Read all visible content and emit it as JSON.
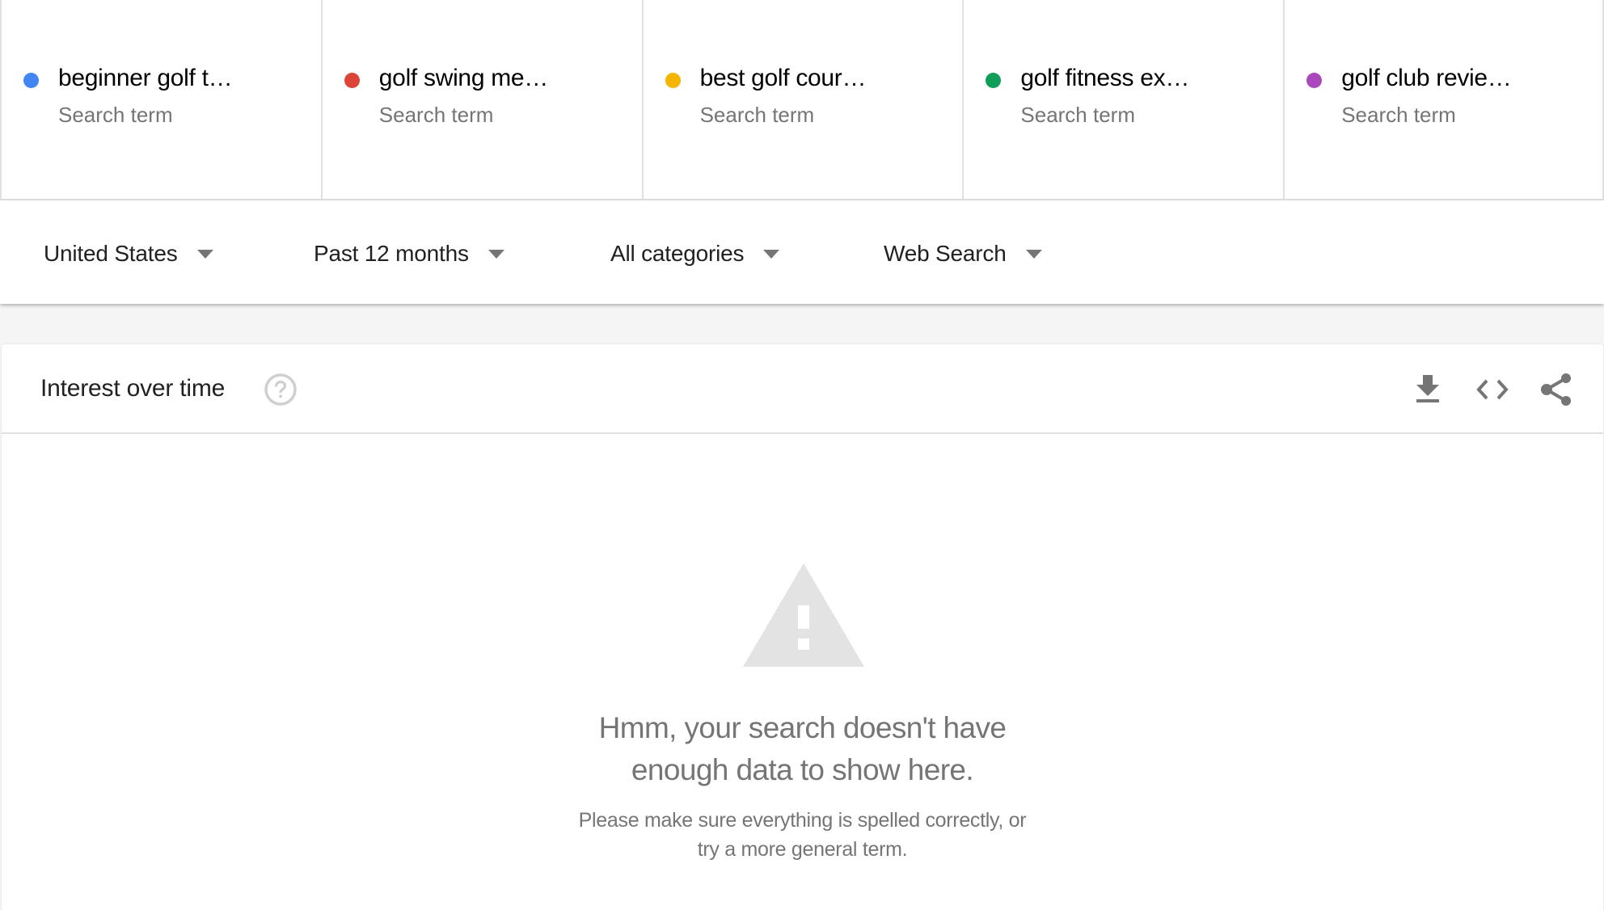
{
  "search_terms": [
    {
      "label": "beginner golf t…",
      "type": "Search term",
      "color": "#4285f4"
    },
    {
      "label": "golf swing me…",
      "type": "Search term",
      "color": "#db4437"
    },
    {
      "label": "best golf cour…",
      "type": "Search term",
      "color": "#f4b400"
    },
    {
      "label": "golf fitness ex…",
      "type": "Search term",
      "color": "#0f9d58"
    },
    {
      "label": "golf club revie…",
      "type": "Search term",
      "color": "#ab47bc"
    }
  ],
  "filters": {
    "region": "United States",
    "time_range": "Past 12 months",
    "category": "All categories",
    "search_type": "Web Search"
  },
  "interest_over_time": {
    "title": "Interest over time",
    "help_icon": "help-circle-icon",
    "actions": {
      "download": "download-icon",
      "embed": "code-embed-icon",
      "share": "share-icon"
    },
    "empty_state": {
      "icon": "warning-icon",
      "title_line1": "Hmm, your search doesn't have",
      "title_line2": "enough data to show here.",
      "subtitle_line1": "Please make sure everything is spelled correctly, or",
      "subtitle_line2": "try a more general term."
    }
  }
}
